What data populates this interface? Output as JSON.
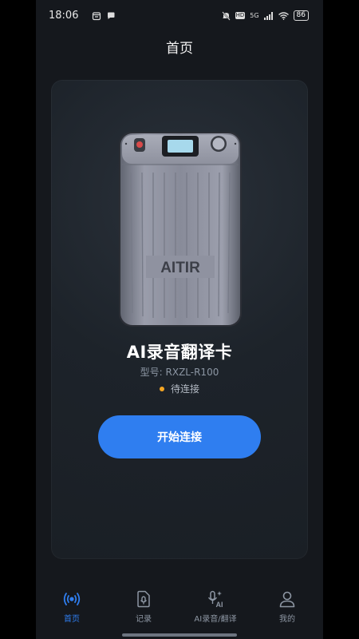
{
  "status_bar": {
    "time": "18:06",
    "battery": "86",
    "signal_label": "5G",
    "hd_label": "HD"
  },
  "header": {
    "title": "首页"
  },
  "device": {
    "brand_text": "AITIR",
    "name": "AI录音翻译卡",
    "model": "型号: RXZL-R100",
    "status": "待连接",
    "status_color": "#f5a623"
  },
  "actions": {
    "start_label": "开始连接"
  },
  "bottom_nav": [
    {
      "label": "首页",
      "icon": "broadcast-icon",
      "active": true
    },
    {
      "label": "记录",
      "icon": "record-file-icon",
      "active": false
    },
    {
      "label": "AI录音/翻译",
      "icon": "ai-mic-icon",
      "active": false
    },
    {
      "label": "我的",
      "icon": "user-icon",
      "active": false
    }
  ],
  "colors": {
    "accent": "#2f7ef0",
    "background": "#15181d",
    "card": "#1d232a",
    "pending": "#f5a623"
  }
}
